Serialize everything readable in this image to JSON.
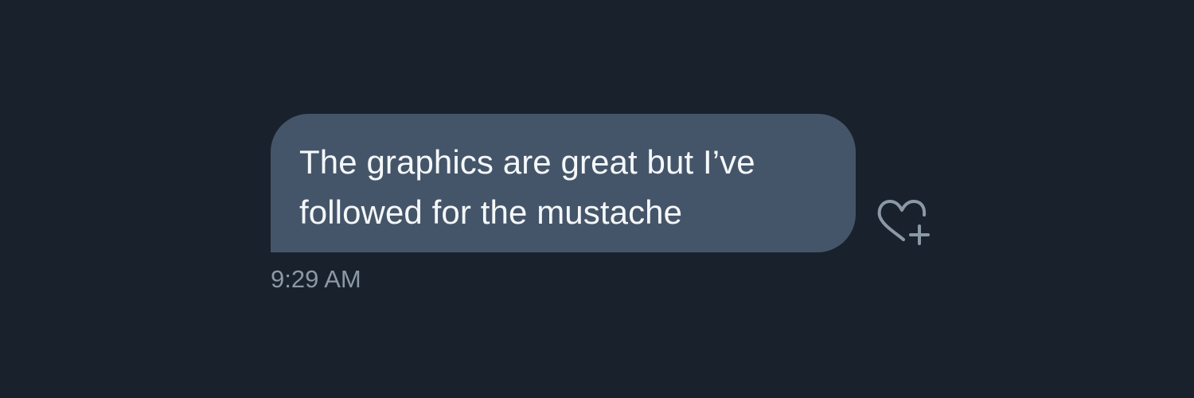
{
  "message": {
    "lines": [
      "The graphics are great but I’ve",
      "followed for the mustache"
    ],
    "timestamp": "9:29 AM"
  },
  "actions": {
    "react_icon": "heart-plus-icon"
  },
  "colors": {
    "background": "#19212c",
    "bubble": "#455569",
    "message_text": "#f5f8fa",
    "timestamp": "#8b98a5",
    "icon": "#8b98a5"
  }
}
